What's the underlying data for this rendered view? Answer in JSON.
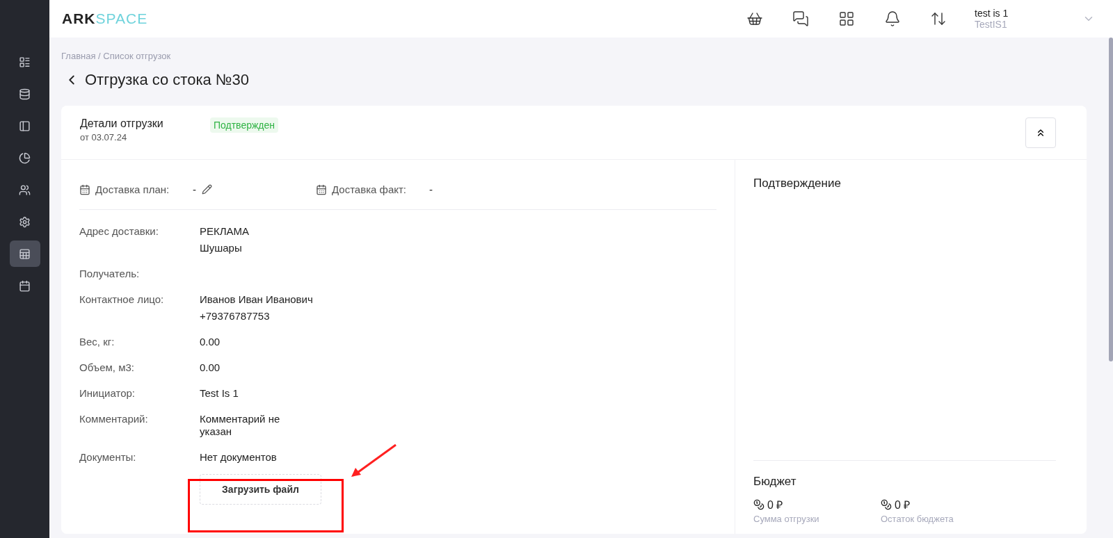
{
  "logo": {
    "dark": "ARK",
    "light": "SPACE"
  },
  "sidebar": {
    "items": [
      {
        "selected": false
      },
      {
        "selected": false
      },
      {
        "selected": false
      },
      {
        "selected": false
      },
      {
        "selected": false
      },
      {
        "selected": false
      },
      {
        "selected": true
      },
      {
        "selected": false
      }
    ]
  },
  "header": {
    "user": {
      "name": "test is 1",
      "org": "TestIS1"
    }
  },
  "breadcrumb": "Главная / Список отгрузок",
  "page_title": "Отгрузка со стока №30",
  "card": {
    "title": "Детали отгрузки",
    "date": "от 03.07.24",
    "status": "Подтвержден",
    "dates": [
      {
        "label": "Доставка план:",
        "value": "-",
        "editable": true
      },
      {
        "label": "Доставка факт:",
        "value": "-",
        "editable": false
      }
    ],
    "fields": [
      {
        "label": "Адрес доставки:",
        "lines": [
          "РЕКЛАМА",
          "Шушары"
        ]
      },
      {
        "label": "Получатель:"
      },
      {
        "label": "Контактное лицо:",
        "lines": [
          "Иванов Иван Иванович",
          "+79376787753"
        ]
      },
      {
        "label": "Вес, кг:",
        "lines": [
          "0.00"
        ]
      },
      {
        "label": "Объем, м3:",
        "lines": [
          "0.00"
        ]
      },
      {
        "label": "Инициатор:",
        "lines": [
          "Test Is 1"
        ]
      },
      {
        "label": "Комментарий:",
        "lines": [
          "Комментарий не указан"
        ],
        "kind": "wrap"
      },
      {
        "label": "Документы:",
        "lines": [
          "Нет документов"
        ]
      }
    ],
    "upload_button": "Загрузить файл",
    "confirmation_title": "Подтверждение",
    "budget": {
      "title": "Бюджет",
      "items": [
        {
          "amount": "0 ₽",
          "caption": "Сумма отгрузки"
        },
        {
          "amount": "0 ₽",
          "caption": "Остаток бюджета"
        }
      ]
    }
  },
  "annotation": {
    "highlight": true
  }
}
